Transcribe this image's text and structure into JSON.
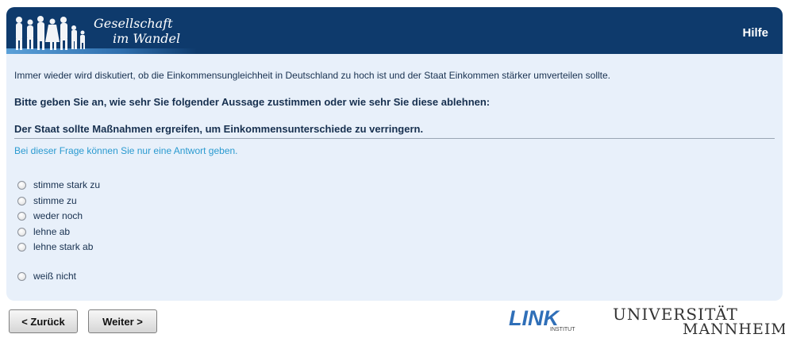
{
  "header": {
    "logo_line1": "Gesellschaft",
    "logo_line2": "im Wandel",
    "help_label": "Hilfe",
    "brand_color": "#0e3a6c"
  },
  "survey": {
    "intro": "Immer wieder wird diskutiert, ob die Einkommensungleichheit in Deutschland zu hoch ist und der Staat Einkommen stärker umverteilen sollte.",
    "instruction": "Bitte geben Sie an, wie sehr Sie folgender Aussage zustimmen oder wie sehr Sie diese ablehnen:",
    "statement": "Der Staat sollte Maßnahmen ergreifen, um Einkommensunterschiede zu verringern.",
    "hint": "Bei dieser Frage können Sie nur eine Antwort geben.",
    "options": [
      {
        "label": "stimme stark zu"
      },
      {
        "label": "stimme zu"
      },
      {
        "label": "weder noch"
      },
      {
        "label": "lehne ab"
      },
      {
        "label": "lehne stark ab"
      },
      {
        "label": "weiß nicht"
      }
    ]
  },
  "navigation": {
    "back_label": "< Zurück",
    "next_label": "Weiter >"
  },
  "footer": {
    "link_logo": "LINK",
    "link_sub": "INSTITUT",
    "uni_line1": "UNIVERSITÄT",
    "uni_line2": "MANNHEIM"
  }
}
